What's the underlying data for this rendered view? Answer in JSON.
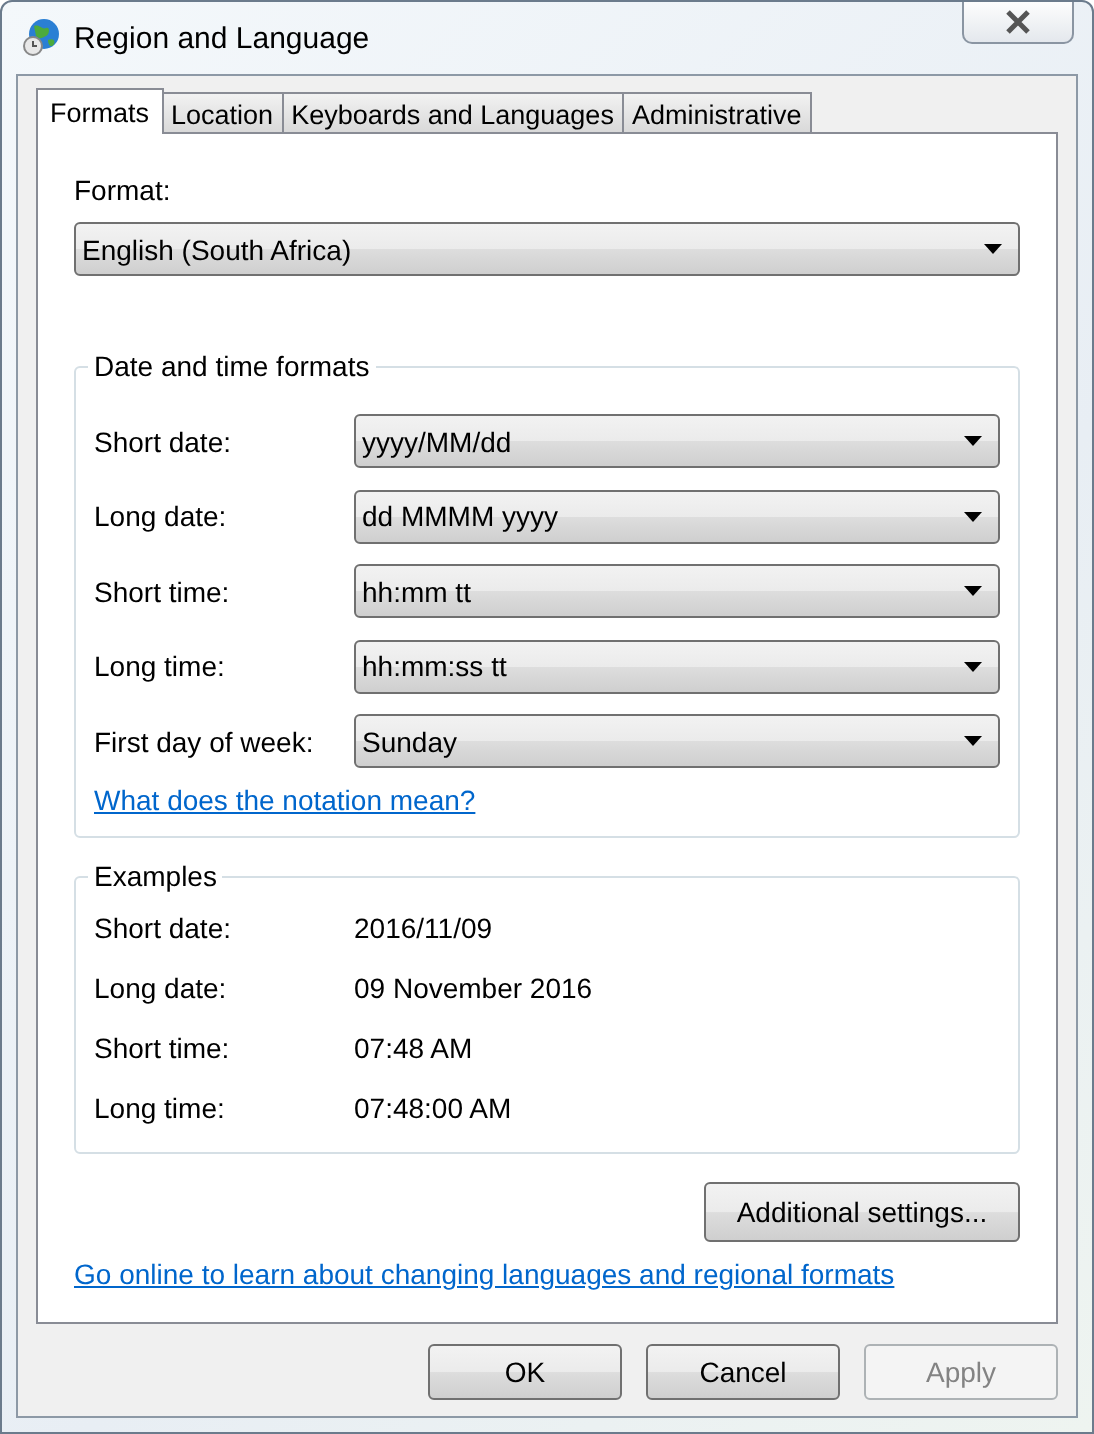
{
  "window": {
    "title": "Region and Language"
  },
  "tabs": [
    {
      "label": "Formats",
      "selected": true
    },
    {
      "label": "Location",
      "selected": false
    },
    {
      "label": "Keyboards and Languages",
      "selected": false
    },
    {
      "label": "Administrative",
      "selected": false
    }
  ],
  "format": {
    "label": "Format:",
    "value": "English (South Africa)"
  },
  "date_time_formats": {
    "title": "Date and time formats",
    "rows": [
      {
        "label": "Short date:",
        "value": "yyyy/MM/dd"
      },
      {
        "label": "Long date:",
        "value": "dd MMMM yyyy"
      },
      {
        "label": "Short time:",
        "value": "hh:mm tt"
      },
      {
        "label": "Long time:",
        "value": "hh:mm:ss tt"
      },
      {
        "label": "First day of week:",
        "value": "Sunday"
      }
    ],
    "link": "What does the notation mean?"
  },
  "examples": {
    "title": "Examples",
    "rows": [
      {
        "label": "Short date:",
        "value": "2016/11/09"
      },
      {
        "label": "Long date:",
        "value": "09 November 2016"
      },
      {
        "label": "Short time:",
        "value": "07:48 AM"
      },
      {
        "label": "Long time:",
        "value": "07:48:00 AM"
      }
    ]
  },
  "additional_button": "Additional settings...",
  "online_link": "Go online to learn about changing languages and regional formats",
  "buttons": [
    {
      "label": "OK",
      "disabled": false
    },
    {
      "label": "Cancel",
      "disabled": false
    },
    {
      "label": "Apply",
      "disabled": true
    }
  ]
}
